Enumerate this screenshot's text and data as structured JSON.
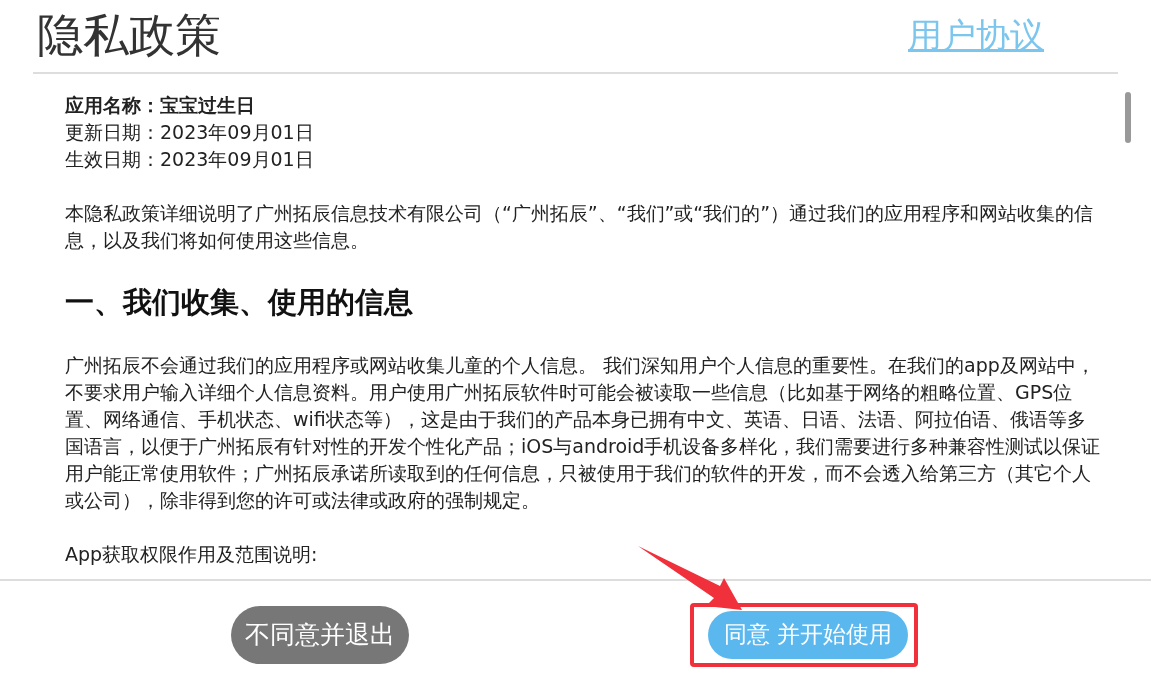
{
  "header": {
    "title": "隐私政策",
    "link": "用户协议"
  },
  "meta": [
    {
      "text": "应用名称：宝宝过生日",
      "kind": "bold"
    },
    {
      "text": "更新日期：2023年09月01日",
      "kind": "plain"
    },
    {
      "text": "生效日期：2023年09月01日",
      "kind": "plain"
    }
  ],
  "blocks": [
    {
      "kind": "paragraph",
      "text": "本隐私政策详细说明了广州拓辰信息技术有限公司（“广州拓辰”、“我们”或“我们的”）通过我们的应用程序和网站收集的信息，以及我们将如何使用这些信息。"
    },
    {
      "kind": "heading",
      "text": "一、我们收集、使用的信息"
    },
    {
      "kind": "paragraph",
      "text": "广州拓辰不会通过我们的应用程序或网站收集儿童的个人信息。 我们深知用户个人信息的重要性。在我们的app及网站中，不要求用户输入详细个人信息资料。用户使用广州拓辰软件时可能会被读取一些信息（比如基于网络的粗略位置、GPS位置、网络通信、手机状态、wifi状态等），这是由于我们的产品本身已拥有中文、英语、日语、法语、阿拉伯语、俄语等多国语言，以便于广州拓辰有针对性的开发个性化产品；iOS与android手机设备多样化，我们需要进行多种兼容性测试以保证用户能正常使用软件；广州拓辰承诺所读取到的任何信息，只被使用于我们的软件的开发，而不会透入给第三方（其它个人或公司），除非得到您的许可或法律或政府的强制规定。"
    },
    {
      "kind": "paragraph",
      "text": "App获取权限作用及范围说明:"
    }
  ],
  "buttons": [
    {
      "label": "不同意并退出",
      "kind": "decline",
      "highlighted": false
    },
    {
      "label": "同意 并开始使用",
      "kind": "accept",
      "highlighted": true
    }
  ]
}
